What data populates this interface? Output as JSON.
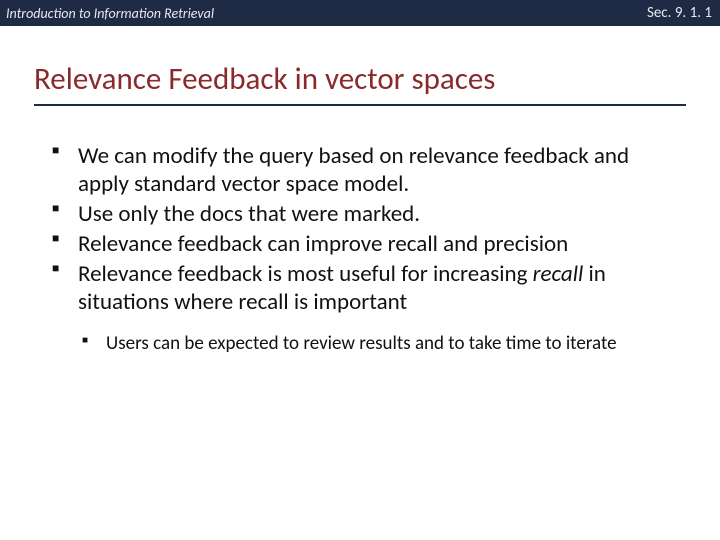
{
  "header": {
    "left": "Introduction to Information Retrieval",
    "right": "Sec. 9. 1. 1"
  },
  "title": "Relevance Feedback in vector spaces",
  "bullets": {
    "b1": "We can modify the query based on relevance feedback and apply standard vector space model.",
    "b2": "Use only the docs that were marked.",
    "b3": "Relevance feedback can improve recall and precision",
    "b4_pre": "Relevance feedback is most useful for increasing ",
    "b4_em": "recall",
    "b4_post": " in situations where recall is important",
    "sub1": "Users can be expected to review results and to take time to iterate"
  }
}
